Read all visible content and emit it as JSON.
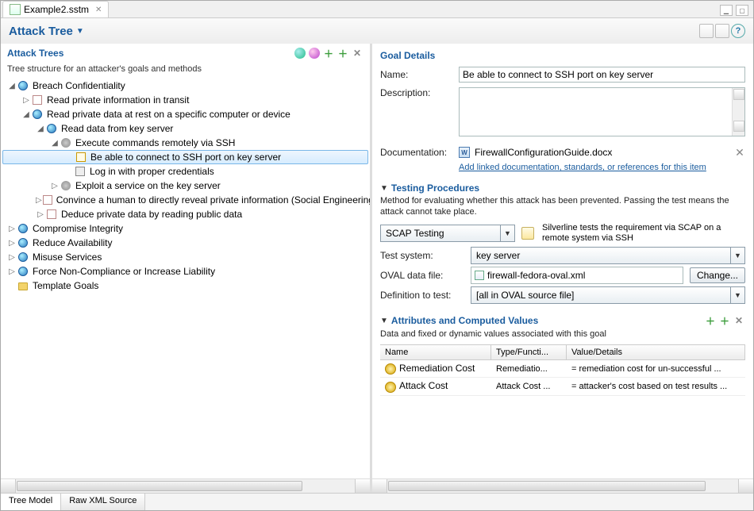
{
  "tab": {
    "filename": "Example2.sstm"
  },
  "header": {
    "title": "Attack Tree"
  },
  "left": {
    "title": "Attack Trees",
    "subtitle": "Tree structure for an attacker's goals and methods",
    "nodes": {
      "n0": "Breach Confidentiality",
      "n1": "Read private information in transit",
      "n2": "Read private data at rest on a specific computer or device",
      "n3": "Read data from key server",
      "n4": "Execute commands remotely via SSH",
      "n5": "Be able to connect to SSH port on key server",
      "n6": "Log in with proper credentials",
      "n7": "Exploit a service on the key server",
      "n8": "Convince a human to directly reveal private information (Social Engineering)",
      "n9": "Deduce private data by reading public data",
      "n10": "Compromise Integrity",
      "n11": "Reduce Availability",
      "n12": "Misuse Services",
      "n13": "Force Non-Compliance or Increase Liability",
      "n14": "Template Goals"
    }
  },
  "right": {
    "title": "Goal Details",
    "name_label": "Name:",
    "name_value": "Be able to connect to SSH port on key server",
    "desc_label": "Description:",
    "doc_label": "Documentation:",
    "doc_file": "FirewallConfigurationGuide.docx",
    "doc_link": "Add linked documentation, standards, or references for this item",
    "testing": {
      "title": "Testing Procedures",
      "desc": "Method for evaluating whether this attack has been prevented.  Passing the test means the attack cannot take place.",
      "method": "SCAP Testing",
      "method_desc": "Silverline tests the requirement via SCAP on a remote system via SSH",
      "test_system_label": "Test system:",
      "test_system": "key server",
      "oval_label": "OVAL data file:",
      "oval_file": "firewall-fedora-oval.xml",
      "change_btn": "Change...",
      "def_label": "Definition to test:",
      "def_value": "[all in OVAL source file]"
    },
    "attrs": {
      "title": "Attributes and Computed Values",
      "desc": "Data and fixed or dynamic values associated with this goal",
      "col_name": "Name",
      "col_type": "Type/Functi...",
      "col_val": "Value/Details",
      "rows": [
        {
          "name": "Remediation Cost",
          "type": "Remediatio...",
          "val": "= remediation cost for un-successful ..."
        },
        {
          "name": "Attack Cost",
          "type": "Attack Cost ...",
          "val": "= attacker's cost based on test results ..."
        }
      ]
    }
  },
  "bottom_tabs": {
    "a": "Tree Model",
    "b": "Raw XML Source"
  }
}
